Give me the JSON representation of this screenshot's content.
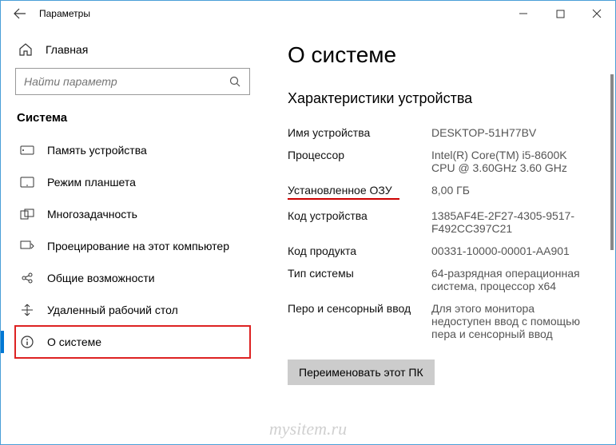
{
  "window": {
    "title": "Параметры"
  },
  "sidebar": {
    "home": "Главная",
    "search_placeholder": "Найти параметр",
    "section": "Система",
    "items": [
      {
        "label": "Память устройства"
      },
      {
        "label": "Режим планшета"
      },
      {
        "label": "Многозадачность"
      },
      {
        "label": "Проецирование на этот компьютер"
      },
      {
        "label": "Общие возможности"
      },
      {
        "label": "Удаленный рабочий стол"
      },
      {
        "label": "О системе"
      }
    ]
  },
  "main": {
    "title": "О системе",
    "section": "Характеристики устройства",
    "specs": {
      "device_name_label": "Имя устройства",
      "device_name_value": "DESKTOP-51H77BV",
      "cpu_label": "Процессор",
      "cpu_value": "Intel(R) Core(TM) i5-8600K CPU @ 3.60GHz   3.60 GHz",
      "ram_label": "Установленное ОЗУ",
      "ram_value": "8,00 ГБ",
      "device_id_label": "Код устройства",
      "device_id_value": "1385AF4E-2F27-4305-9517-F492CC397C21",
      "product_id_label": "Код продукта",
      "product_id_value": "00331-10000-00001-AA901",
      "system_type_label": "Тип системы",
      "system_type_value": "64-разрядная операционная система, процессор x64",
      "pen_label": "Перо и сенсорный ввод",
      "pen_value": "Для этого монитора недоступен ввод с помощью пера и сенсорный ввод"
    },
    "rename_button": "Переименовать этот ПК"
  },
  "watermark": "mysitem.ru"
}
